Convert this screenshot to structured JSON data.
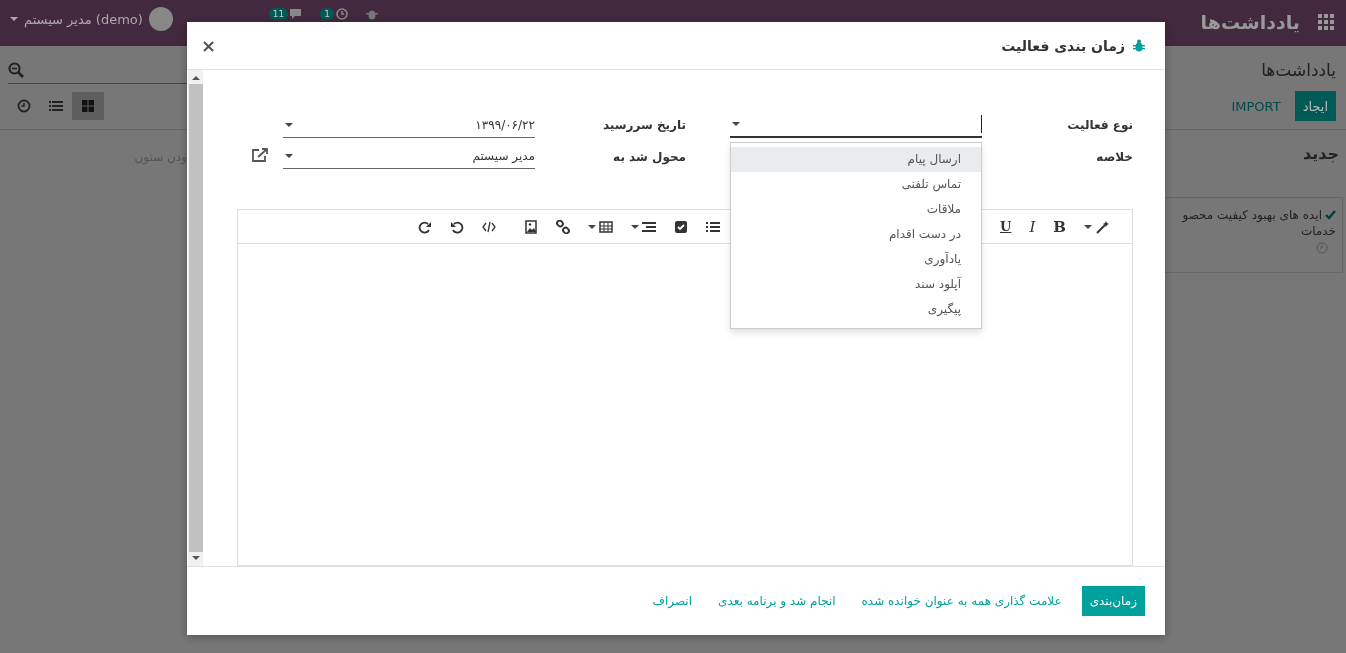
{
  "navbar": {
    "app_title": "یادداشت‌ها",
    "activity_count": "1",
    "message_count": "11",
    "user": "مدیر سیستم (demo)"
  },
  "control_panel": {
    "breadcrumb": "یادداشت‌ها",
    "buttons": [
      {
        "label": "ایجاد",
        "kind": "primary"
      },
      {
        "label": "IMPORT",
        "kind": "link"
      }
    ],
    "views": [
      {
        "kind": "activity",
        "selected": false
      },
      {
        "kind": "list",
        "selected": false
      },
      {
        "kind": "kanban",
        "selected": true
      }
    ]
  },
  "kanban": {
    "column": {
      "title": "جدید",
      "card": {
        "done": true,
        "title_line_1": "ایده های بهبود کیفیت محصو",
        "title_line_2": "خدمات"
      }
    },
    "add_column": "ودن ستون"
  },
  "dialog": {
    "title": "زمان بندی فعالیت",
    "close": "×",
    "fields": [
      {
        "kind": "select",
        "label": "نوع فعالیت",
        "focused": true
      },
      {
        "kind": "date",
        "label": "تاریخ سررسید",
        "value": "۱۳۹۹/۰۶/۲۲"
      },
      {
        "kind": "text",
        "label": "خلاصه"
      },
      {
        "kind": "many2one",
        "label": "محول شد به",
        "value": "مدیر سیستم"
      }
    ],
    "dropdown": [
      {
        "label": "ارسال پیام",
        "selected": true
      },
      {
        "label": "تماس تلفنی",
        "selected": false
      },
      {
        "label": "ملاقات",
        "selected": false
      },
      {
        "label": "در دست اقدام",
        "selected": false
      },
      {
        "label": "یادآوری",
        "selected": false
      },
      {
        "label": "آپلود سند",
        "selected": false
      },
      {
        "label": "پیگیری",
        "selected": false
      }
    ],
    "format_buttons": [
      "B",
      "I",
      "U"
    ],
    "footer": [
      {
        "label": "زمان‌بندی",
        "kind": "primary"
      },
      {
        "label": "علامت گذاری همه به عنوان خوانده شده",
        "kind": "link"
      },
      {
        "label": "انجام شد و برنامه بعدی",
        "kind": "link"
      },
      {
        "label": "انصراف",
        "kind": "link"
      }
    ]
  }
}
